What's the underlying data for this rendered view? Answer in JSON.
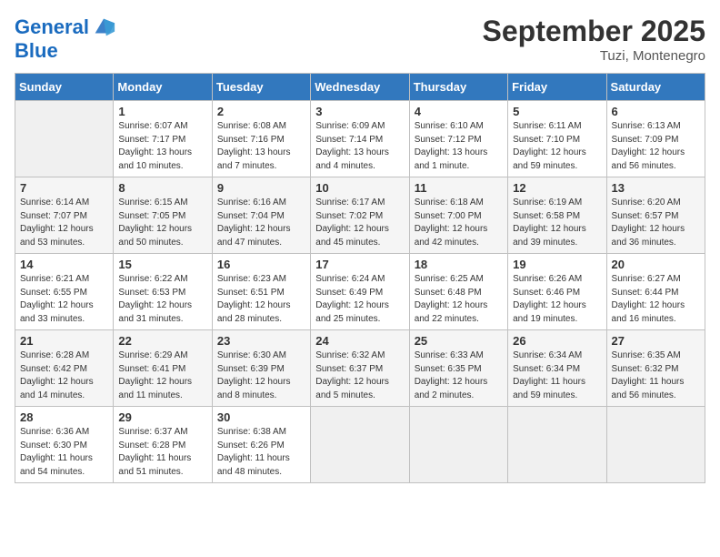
{
  "header": {
    "logo_line1": "General",
    "logo_line2": "Blue",
    "month_title": "September 2025",
    "location": "Tuzi, Montenegro"
  },
  "days_of_week": [
    "Sunday",
    "Monday",
    "Tuesday",
    "Wednesday",
    "Thursday",
    "Friday",
    "Saturday"
  ],
  "weeks": [
    [
      {
        "num": "",
        "sunrise": "",
        "sunset": "",
        "daylight": ""
      },
      {
        "num": "1",
        "sunrise": "Sunrise: 6:07 AM",
        "sunset": "Sunset: 7:17 PM",
        "daylight": "Daylight: 13 hours and 10 minutes."
      },
      {
        "num": "2",
        "sunrise": "Sunrise: 6:08 AM",
        "sunset": "Sunset: 7:16 PM",
        "daylight": "Daylight: 13 hours and 7 minutes."
      },
      {
        "num": "3",
        "sunrise": "Sunrise: 6:09 AM",
        "sunset": "Sunset: 7:14 PM",
        "daylight": "Daylight: 13 hours and 4 minutes."
      },
      {
        "num": "4",
        "sunrise": "Sunrise: 6:10 AM",
        "sunset": "Sunset: 7:12 PM",
        "daylight": "Daylight: 13 hours and 1 minute."
      },
      {
        "num": "5",
        "sunrise": "Sunrise: 6:11 AM",
        "sunset": "Sunset: 7:10 PM",
        "daylight": "Daylight: 12 hours and 59 minutes."
      },
      {
        "num": "6",
        "sunrise": "Sunrise: 6:13 AM",
        "sunset": "Sunset: 7:09 PM",
        "daylight": "Daylight: 12 hours and 56 minutes."
      }
    ],
    [
      {
        "num": "7",
        "sunrise": "Sunrise: 6:14 AM",
        "sunset": "Sunset: 7:07 PM",
        "daylight": "Daylight: 12 hours and 53 minutes."
      },
      {
        "num": "8",
        "sunrise": "Sunrise: 6:15 AM",
        "sunset": "Sunset: 7:05 PM",
        "daylight": "Daylight: 12 hours and 50 minutes."
      },
      {
        "num": "9",
        "sunrise": "Sunrise: 6:16 AM",
        "sunset": "Sunset: 7:04 PM",
        "daylight": "Daylight: 12 hours and 47 minutes."
      },
      {
        "num": "10",
        "sunrise": "Sunrise: 6:17 AM",
        "sunset": "Sunset: 7:02 PM",
        "daylight": "Daylight: 12 hours and 45 minutes."
      },
      {
        "num": "11",
        "sunrise": "Sunrise: 6:18 AM",
        "sunset": "Sunset: 7:00 PM",
        "daylight": "Daylight: 12 hours and 42 minutes."
      },
      {
        "num": "12",
        "sunrise": "Sunrise: 6:19 AM",
        "sunset": "Sunset: 6:58 PM",
        "daylight": "Daylight: 12 hours and 39 minutes."
      },
      {
        "num": "13",
        "sunrise": "Sunrise: 6:20 AM",
        "sunset": "Sunset: 6:57 PM",
        "daylight": "Daylight: 12 hours and 36 minutes."
      }
    ],
    [
      {
        "num": "14",
        "sunrise": "Sunrise: 6:21 AM",
        "sunset": "Sunset: 6:55 PM",
        "daylight": "Daylight: 12 hours and 33 minutes."
      },
      {
        "num": "15",
        "sunrise": "Sunrise: 6:22 AM",
        "sunset": "Sunset: 6:53 PM",
        "daylight": "Daylight: 12 hours and 31 minutes."
      },
      {
        "num": "16",
        "sunrise": "Sunrise: 6:23 AM",
        "sunset": "Sunset: 6:51 PM",
        "daylight": "Daylight: 12 hours and 28 minutes."
      },
      {
        "num": "17",
        "sunrise": "Sunrise: 6:24 AM",
        "sunset": "Sunset: 6:49 PM",
        "daylight": "Daylight: 12 hours and 25 minutes."
      },
      {
        "num": "18",
        "sunrise": "Sunrise: 6:25 AM",
        "sunset": "Sunset: 6:48 PM",
        "daylight": "Daylight: 12 hours and 22 minutes."
      },
      {
        "num": "19",
        "sunrise": "Sunrise: 6:26 AM",
        "sunset": "Sunset: 6:46 PM",
        "daylight": "Daylight: 12 hours and 19 minutes."
      },
      {
        "num": "20",
        "sunrise": "Sunrise: 6:27 AM",
        "sunset": "Sunset: 6:44 PM",
        "daylight": "Daylight: 12 hours and 16 minutes."
      }
    ],
    [
      {
        "num": "21",
        "sunrise": "Sunrise: 6:28 AM",
        "sunset": "Sunset: 6:42 PM",
        "daylight": "Daylight: 12 hours and 14 minutes."
      },
      {
        "num": "22",
        "sunrise": "Sunrise: 6:29 AM",
        "sunset": "Sunset: 6:41 PM",
        "daylight": "Daylight: 12 hours and 11 minutes."
      },
      {
        "num": "23",
        "sunrise": "Sunrise: 6:30 AM",
        "sunset": "Sunset: 6:39 PM",
        "daylight": "Daylight: 12 hours and 8 minutes."
      },
      {
        "num": "24",
        "sunrise": "Sunrise: 6:32 AM",
        "sunset": "Sunset: 6:37 PM",
        "daylight": "Daylight: 12 hours and 5 minutes."
      },
      {
        "num": "25",
        "sunrise": "Sunrise: 6:33 AM",
        "sunset": "Sunset: 6:35 PM",
        "daylight": "Daylight: 12 hours and 2 minutes."
      },
      {
        "num": "26",
        "sunrise": "Sunrise: 6:34 AM",
        "sunset": "Sunset: 6:34 PM",
        "daylight": "Daylight: 11 hours and 59 minutes."
      },
      {
        "num": "27",
        "sunrise": "Sunrise: 6:35 AM",
        "sunset": "Sunset: 6:32 PM",
        "daylight": "Daylight: 11 hours and 56 minutes."
      }
    ],
    [
      {
        "num": "28",
        "sunrise": "Sunrise: 6:36 AM",
        "sunset": "Sunset: 6:30 PM",
        "daylight": "Daylight: 11 hours and 54 minutes."
      },
      {
        "num": "29",
        "sunrise": "Sunrise: 6:37 AM",
        "sunset": "Sunset: 6:28 PM",
        "daylight": "Daylight: 11 hours and 51 minutes."
      },
      {
        "num": "30",
        "sunrise": "Sunrise: 6:38 AM",
        "sunset": "Sunset: 6:26 PM",
        "daylight": "Daylight: 11 hours and 48 minutes."
      },
      {
        "num": "",
        "sunrise": "",
        "sunset": "",
        "daylight": ""
      },
      {
        "num": "",
        "sunrise": "",
        "sunset": "",
        "daylight": ""
      },
      {
        "num": "",
        "sunrise": "",
        "sunset": "",
        "daylight": ""
      },
      {
        "num": "",
        "sunrise": "",
        "sunset": "",
        "daylight": ""
      }
    ]
  ]
}
